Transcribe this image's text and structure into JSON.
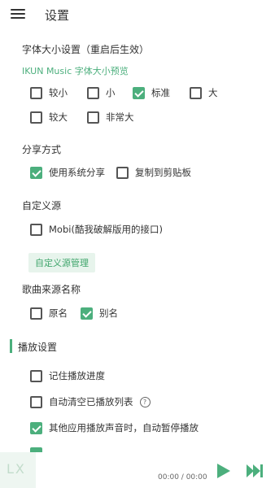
{
  "header": {
    "title": "设置",
    "menu_icon": "hamburger-menu-icon"
  },
  "colors": {
    "accent": "#4caf7d"
  },
  "font_size": {
    "title": "字体大小设置（重启后生效）",
    "preview_link": "IKUN Music 字体大小预览",
    "options": [
      {
        "label": "较小",
        "checked": false
      },
      {
        "label": "小",
        "checked": false
      },
      {
        "label": "标准",
        "checked": true
      },
      {
        "label": "大",
        "checked": false
      },
      {
        "label": "较大",
        "checked": false
      },
      {
        "label": "非常大",
        "checked": false
      }
    ]
  },
  "share": {
    "title": "分享方式",
    "options": [
      {
        "label": "使用系统分享",
        "checked": true
      },
      {
        "label": "复制到剪贴板",
        "checked": false
      }
    ]
  },
  "custom_source": {
    "title": "自定义源",
    "options": [
      {
        "label": "Mobi(酷我破解版用的接口)",
        "checked": false
      }
    ],
    "manage_button": "自定义源管理"
  },
  "source_name": {
    "title": "歌曲来源名称",
    "options": [
      {
        "label": "原名",
        "checked": false
      },
      {
        "label": "别名",
        "checked": true
      }
    ]
  },
  "playback": {
    "title": "播放设置",
    "options": [
      {
        "label": "记住播放进度",
        "checked": false
      },
      {
        "label": "自动清空已播放列表",
        "checked": false,
        "help_icon": "help-circle-icon"
      },
      {
        "label": "其他应用播放声音时，自动暂停播放",
        "checked": true
      }
    ]
  },
  "player": {
    "logo_text": "LX",
    "time": "00:00 / 00:00",
    "play_icon": "play-icon",
    "next_icon": "skip-next-icon"
  }
}
